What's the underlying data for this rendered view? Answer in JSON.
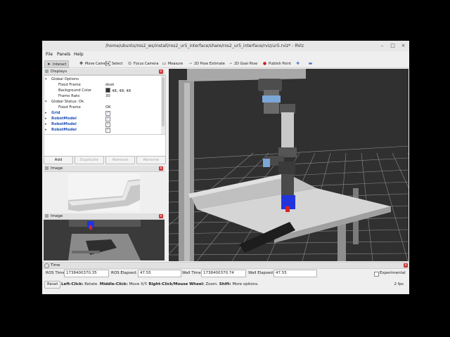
{
  "window": {
    "title": "/home/ubuntu/ros2_ws/install/ros2_ur5_interface/share/ros2_ur5_interface/rviz/ur5.rviz* - RViz",
    "controls": [
      "–",
      "□",
      "×"
    ]
  },
  "menubar": {
    "items": [
      "File",
      "Panels",
      "Help"
    ]
  },
  "toolbar": {
    "items": [
      {
        "label": "Interact",
        "icon": "cursor-icon",
        "active": true
      },
      {
        "label": "Move Camera",
        "icon": "move-camera-icon",
        "active": false
      },
      {
        "label": "Select",
        "icon": "select-icon",
        "active": false
      },
      {
        "label": "Focus Camera",
        "icon": "focus-camera-icon",
        "active": false
      },
      {
        "label": "Measure",
        "icon": "measure-icon",
        "active": false
      },
      {
        "label": "2D Pose Estimate",
        "icon": "pose-estimate-icon",
        "active": false
      },
      {
        "label": "2D Goal Pose",
        "icon": "goal-pose-icon",
        "active": false
      },
      {
        "label": "Publish Point",
        "icon": "publish-point-icon",
        "active": false
      }
    ]
  },
  "displays": {
    "title": "Displays",
    "rows": [
      {
        "label": "Global Options",
        "value": "",
        "indent": 1,
        "arrow": "▾",
        "style": "normal",
        "check": false
      },
      {
        "label": "Fixed Frame",
        "value": "desk",
        "indent": 3,
        "arrow": "",
        "style": "normal",
        "check": false
      },
      {
        "label": "Background Color",
        "value": "48; 48; 48",
        "indent": 3,
        "arrow": "",
        "style": "normal",
        "check": false,
        "swatch": "#303030"
      },
      {
        "label": "Frame Rate",
        "value": "30",
        "indent": 3,
        "arrow": "",
        "style": "normal",
        "check": false
      },
      {
        "label": "Global Status: Ok",
        "value": "",
        "indent": 1,
        "arrow": "▾",
        "style": "normal",
        "check": false
      },
      {
        "label": "Fixed Frame",
        "value": "OK",
        "indent": 3,
        "arrow": "",
        "style": "normal",
        "check": false
      },
      {
        "label": "Grid",
        "value": "",
        "indent": 1,
        "arrow": "▸",
        "style": "blue",
        "check": true
      },
      {
        "label": "RobotModel",
        "value": "",
        "indent": 1,
        "arrow": "▸",
        "style": "blue",
        "check": true
      },
      {
        "label": "RobotModel",
        "value": "",
        "indent": 1,
        "arrow": "▸",
        "style": "blue",
        "check": true
      },
      {
        "label": "RobotModel",
        "value": "",
        "indent": 1,
        "arrow": "▸",
        "style": "blue",
        "check": true
      }
    ],
    "buttons": {
      "add": "Add",
      "duplicate": "Duplicate",
      "remove": "Remove",
      "rename": "Rename"
    }
  },
  "image_panels": [
    {
      "title": "Image"
    },
    {
      "title": "Image"
    }
  ],
  "time": {
    "title": "Time",
    "ros_time_label": "ROS Time:",
    "ros_time": "1738400370.35",
    "ros_elapsed_label": "ROS Elapsed:",
    "ros_elapsed": "47.55",
    "wall_time_label": "Wall Time:",
    "wall_time": "1738400370.74",
    "wall_elapsed_label": "Wall Elapsed:",
    "wall_elapsed": "47.55",
    "experimental": "Experimental"
  },
  "status": {
    "reset": "Reset",
    "hint_left_key": "Left-Click:",
    "hint_left": " Rotate. ",
    "hint_middle_key": "Middle-Click:",
    "hint_middle": " Move X/Y. ",
    "hint_right_key": "Right-Click/Mouse Wheel:",
    "hint_right": " Zoom. ",
    "hint_shift_key": "Shift:",
    "hint_shift": " More options.",
    "fps": "2 fps"
  },
  "colors": {
    "viewport_bg": "#303030",
    "accent": "#1e4fb5",
    "gripper": "#2233dd"
  }
}
